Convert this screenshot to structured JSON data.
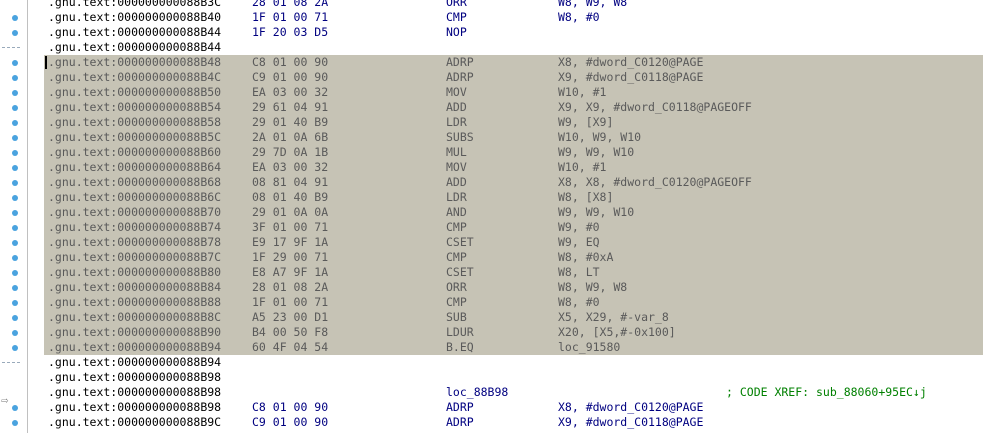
{
  "rows": [
    {
      "addr": ".gnu.text:000000000088B3C",
      "bytes": "28 01 08 2A",
      "mn": "ORR",
      "ops": "W8, W9, W8",
      "sel": false
    },
    {
      "addr": ".gnu.text:000000000088B40",
      "bytes": "1F 01 00 71",
      "mn": "CMP",
      "ops": "W8, #0",
      "sel": false
    },
    {
      "addr": ".gnu.text:000000000088B44",
      "bytes": "1F 20 03 D5",
      "mn": "NOP",
      "ops": "",
      "sel": false
    },
    {
      "addr": ".gnu.text:000000000088B44",
      "bytes": "",
      "mn": "",
      "ops": "",
      "sel": false
    },
    {
      "addr": ".gnu.text:000000000088B48",
      "bytes": "C8 01 00 90",
      "mn": "ADRP",
      "ops": "X8, #dword_C0120@PAGE",
      "sel": true
    },
    {
      "addr": ".gnu.text:000000000088B4C",
      "bytes": "C9 01 00 90",
      "mn": "ADRP",
      "ops": "X9, #dword_C0118@PAGE",
      "sel": true
    },
    {
      "addr": ".gnu.text:000000000088B50",
      "bytes": "EA 03 00 32",
      "mn": "MOV",
      "ops": "W10, #1",
      "sel": true
    },
    {
      "addr": ".gnu.text:000000000088B54",
      "bytes": "29 61 04 91",
      "mn": "ADD",
      "ops": "X9, X9, #dword_C0118@PAGEOFF",
      "sel": true
    },
    {
      "addr": ".gnu.text:000000000088B58",
      "bytes": "29 01 40 B9",
      "mn": "LDR",
      "ops": "W9, [X9]",
      "sel": true
    },
    {
      "addr": ".gnu.text:000000000088B5C",
      "bytes": "2A 01 0A 6B",
      "mn": "SUBS",
      "ops": "W10, W9, W10",
      "sel": true
    },
    {
      "addr": ".gnu.text:000000000088B60",
      "bytes": "29 7D 0A 1B",
      "mn": "MUL",
      "ops": "W9, W9, W10",
      "sel": true
    },
    {
      "addr": ".gnu.text:000000000088B64",
      "bytes": "EA 03 00 32",
      "mn": "MOV",
      "ops": "W10, #1",
      "sel": true
    },
    {
      "addr": ".gnu.text:000000000088B68",
      "bytes": "08 81 04 91",
      "mn": "ADD",
      "ops": "X8, X8, #dword_C0120@PAGEOFF",
      "sel": true
    },
    {
      "addr": ".gnu.text:000000000088B6C",
      "bytes": "08 01 40 B9",
      "mn": "LDR",
      "ops": "W8, [X8]",
      "sel": true
    },
    {
      "addr": ".gnu.text:000000000088B70",
      "bytes": "29 01 0A 0A",
      "mn": "AND",
      "ops": "W9, W9, W10",
      "sel": true
    },
    {
      "addr": ".gnu.text:000000000088B74",
      "bytes": "3F 01 00 71",
      "mn": "CMP",
      "ops": "W9, #0",
      "sel": true
    },
    {
      "addr": ".gnu.text:000000000088B78",
      "bytes": "E9 17 9F 1A",
      "mn": "CSET",
      "ops": "W9, EQ",
      "sel": true
    },
    {
      "addr": ".gnu.text:000000000088B7C",
      "bytes": "1F 29 00 71",
      "mn": "CMP",
      "ops": "W8, #0xA",
      "sel": true
    },
    {
      "addr": ".gnu.text:000000000088B80",
      "bytes": "E8 A7 9F 1A",
      "mn": "CSET",
      "ops": "W8, LT",
      "sel": true
    },
    {
      "addr": ".gnu.text:000000000088B84",
      "bytes": "28 01 08 2A",
      "mn": "ORR",
      "ops": "W8, W9, W8",
      "sel": true
    },
    {
      "addr": ".gnu.text:000000000088B88",
      "bytes": "1F 01 00 71",
      "mn": "CMP",
      "ops": "W8, #0",
      "sel": true
    },
    {
      "addr": ".gnu.text:000000000088B8C",
      "bytes": "A5 23 00 D1",
      "mn": "SUB",
      "ops": "X5, X29, #-var_8",
      "sel": true
    },
    {
      "addr": ".gnu.text:000000000088B90",
      "bytes": "B4 00 50 F8",
      "mn": "LDUR",
      "ops": "X20, [X5,#-0x100]",
      "sel": true
    },
    {
      "addr": ".gnu.text:000000000088B94",
      "bytes": "60 4F 04 54",
      "mn": "B.EQ",
      "ops": "loc_91580",
      "sel": true
    },
    {
      "addr": ".gnu.text:000000000088B94",
      "bytes": "",
      "mn": "",
      "ops": "",
      "sel": false
    },
    {
      "addr": ".gnu.text:000000000088B98",
      "bytes": "",
      "mn": "",
      "ops": "",
      "sel": false
    },
    {
      "addr": ".gnu.text:000000000088B98",
      "bytes": "",
      "mn": "",
      "ops": "",
      "label": "loc_88B98",
      "comment": "; CODE XREF: sub_88060+95EC↓j",
      "sel": false
    },
    {
      "addr": ".gnu.text:000000000088B98",
      "bytes": "C8 01 00 90",
      "mn": "ADRP",
      "ops": "X8, #dword_C0120@PAGE",
      "sel": false
    },
    {
      "addr": ".gnu.text:000000000088B9C",
      "bytes": "C9 01 00 90",
      "mn": "ADRP",
      "ops": "X9, #dword_C0118@PAGE",
      "sel": false
    }
  ]
}
